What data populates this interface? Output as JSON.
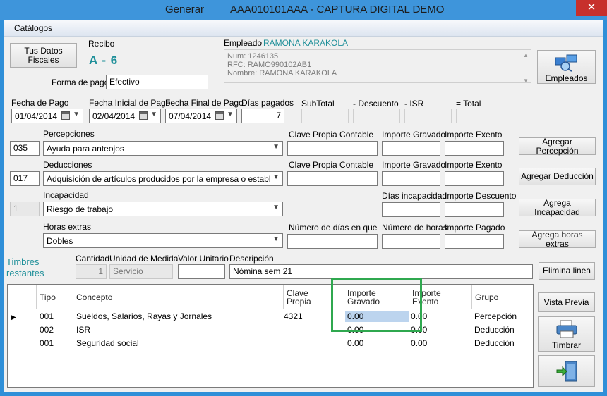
{
  "window": {
    "title_left": "Generar",
    "title_right": "AAA010101AAA  -  CAPTURA DIGITAL DEMO",
    "close_glyph": "✕"
  },
  "menu": {
    "catalogos": "Catálogos"
  },
  "header": {
    "tus_datos_line1": "Tus Datos",
    "tus_datos_line2": "Fiscales",
    "recibo_label": "Recibo",
    "recibo_value": "A - 6",
    "forma_pago_label": "Forma de pago",
    "forma_pago_value": "Efectivo",
    "empleado_label": "Empleado",
    "empleado_name": "RAMONA KARAKOLA",
    "emp_num": "Num: 1246135",
    "emp_rfc": "RFC: RAMO990102AB1",
    "emp_nombre": "Nombre: RAMONA KARAKOLA",
    "empleados_button": "Empleados"
  },
  "dates": {
    "fecha_pago_label": "Fecha de Pago",
    "fecha_pago_value": "01/04/2014",
    "fecha_inicial_label": "Fecha Inicial de Pago",
    "fecha_inicial_value": "02/04/2014",
    "fecha_final_label": "Fecha Final de Pago",
    "fecha_final_value": "07/04/2014",
    "dias_pagados_label": "Días pagados",
    "dias_pagados_value": "7",
    "subtotal_label": "SubTotal",
    "descuento_label": "- Descuento",
    "isr_label": "- ISR",
    "total_label": "= Total"
  },
  "percepciones": {
    "label": "Percepciones",
    "code": "035",
    "value": "Ayuda para anteojos",
    "clave_label": "Clave Propia Contable",
    "gravado_label": "Importe Gravado",
    "exento_label": "Importe Exento",
    "button": "Agregar Percepción"
  },
  "deducciones": {
    "label": "Deducciones",
    "code": "017",
    "value": "Adquisición de artículos producidos por la empresa o establecimien",
    "clave_label": "Clave Propia Contable",
    "gravado_label": "Importe Gravado",
    "exento_label": "Importe Exento",
    "button": "Agregar Deducción"
  },
  "incapacidad": {
    "label": "Incapacidad",
    "code": "1",
    "value": "Riesgo de trabajo",
    "dias_label": "Días incapacidad",
    "descuento_label": "Importe Descuento",
    "button": "Agrega Incapacidad"
  },
  "horas": {
    "label": "Horas extras",
    "value": "Dobles",
    "num_dias_label": "Número de días en que",
    "num_horas_label": "Número de horas",
    "pagado_label": "Importe Pagado",
    "button": "Agrega horas extras"
  },
  "timbres": {
    "line1": "Timbres",
    "line2": "restantes",
    "cantidad_label": "Cantidad",
    "cantidad_value": "1",
    "unidad_label": "Unidad de Medida",
    "unidad_value": "Servicio",
    "valor_label": "Valor Unitario",
    "descripcion_label": "Descripción",
    "descripcion_value": "Nómina sem 21",
    "elimina_button": "Elimina linea"
  },
  "grid": {
    "headers": {
      "tipo": "Tipo",
      "concepto": "Concepto",
      "clave_1": "Clave",
      "clave_2": "Propia",
      "gravado_1": "Importe",
      "gravado_2": "Gravado",
      "exento_1": "Importe",
      "exento_2": "Exento",
      "grupo": "Grupo"
    },
    "rows": [
      {
        "tipo": "001",
        "concepto": "Sueldos, Salarios, Rayas y Jornales",
        "clave": "4321",
        "gravado": "0.00",
        "exento": "0.00",
        "grupo": "Percepción"
      },
      {
        "tipo": "002",
        "concepto": "ISR",
        "clave": "",
        "gravado": "0.00",
        "exento": "0.00",
        "grupo": "Deducción"
      },
      {
        "tipo": "001",
        "concepto": "Seguridad social",
        "clave": "",
        "gravado": "0.00",
        "exento": "0.00",
        "grupo": "Deducción"
      }
    ]
  },
  "side_buttons": {
    "vista_previa": "Vista Previa",
    "timbrar": "Timbrar"
  },
  "colors": {
    "accent_teal": "#1e8f99",
    "highlight_green": "#2fa84f",
    "title_blue": "#3e95db"
  }
}
